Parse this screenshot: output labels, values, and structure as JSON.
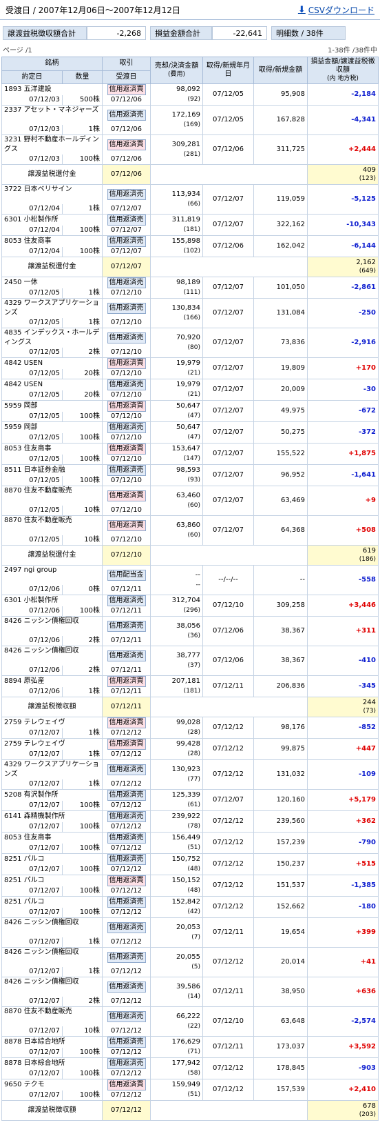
{
  "header": {
    "title": "受渡日 / 2007年12月06日～2007年12月12日",
    "csv_label": "CSVダウンロード"
  },
  "summary": {
    "tax_label": "譲渡益税徴収額合計",
    "tax_value": "-2,268",
    "profit_label": "損益金額合計",
    "profit_value": "-22,641",
    "count_label": "明細数 / 38件"
  },
  "paging": {
    "page": "ページ /1",
    "count": "1-38件 /38件中"
  },
  "columns": {
    "stock": "銘柄",
    "trade_date": "約定日",
    "qty": "数量",
    "type": "取引",
    "settle": "受渡日",
    "sell_amt": "売却/決済金額",
    "fee": "(費用)",
    "acq_date": "取得/新規年月日",
    "acq_amt": "取得/新規金額",
    "pl": "損益金額/譲渡益税徴収額",
    "pl_note": "(内 地方税)"
  },
  "rows": [
    {
      "kind": "trade",
      "stock": "1893 五洋建設",
      "trade": "07/12/03",
      "qty": "500株",
      "type": "信用返済買",
      "side": "buy",
      "settle": "07/12/06",
      "sell": "98,092",
      "fee": "(92)",
      "acq_date": "07/12/05",
      "acq": "95,908",
      "pl": "-2,184"
    },
    {
      "kind": "trade",
      "stock": "2337 アセット・マネジャーズ",
      "trade": "07/12/03",
      "qty": "1株",
      "type": "信用返済売",
      "side": "sell",
      "settle": "07/12/06",
      "sell": "172,169",
      "fee": "(169)",
      "acq_date": "07/12/05",
      "acq": "167,828",
      "pl": "-4,341"
    },
    {
      "kind": "trade",
      "stock": "3231 野村不動産ホールディングス",
      "trade": "07/12/03",
      "qty": "100株",
      "type": "信用返済買",
      "side": "buy",
      "settle": "07/12/06",
      "sell": "309,281",
      "fee": "(281)",
      "acq_date": "07/12/06",
      "acq": "311,725",
      "pl": "+2,444"
    },
    {
      "kind": "tax",
      "label": "譲渡益税還付金",
      "date": "07/12/06",
      "amt": "409",
      "local": "(123)"
    },
    {
      "kind": "trade",
      "stock": "3722 日本ベリサイン",
      "trade": "07/12/04",
      "qty": "1株",
      "type": "信用返済売",
      "side": "sell",
      "settle": "07/12/07",
      "sell": "113,934",
      "fee": "(66)",
      "acq_date": "07/12/07",
      "acq": "119,059",
      "pl": "-5,125"
    },
    {
      "kind": "trade",
      "stock": "6301 小松製作所",
      "trade": "07/12/04",
      "qty": "100株",
      "type": "信用返済売",
      "side": "sell",
      "settle": "07/12/07",
      "sell": "311,819",
      "fee": "(181)",
      "acq_date": "07/12/07",
      "acq": "322,162",
      "pl": "-10,343"
    },
    {
      "kind": "trade",
      "stock": "8053 住友商事",
      "trade": "07/12/04",
      "qty": "100株",
      "type": "信用返済売",
      "side": "sell",
      "settle": "07/12/07",
      "sell": "155,898",
      "fee": "(102)",
      "acq_date": "07/12/06",
      "acq": "162,042",
      "pl": "-6,144"
    },
    {
      "kind": "tax",
      "label": "譲渡益税還付金",
      "date": "07/12/07",
      "amt": "2,162",
      "local": "(649)"
    },
    {
      "kind": "trade",
      "stock": "2450 一休",
      "trade": "07/12/05",
      "qty": "1株",
      "type": "信用返済売",
      "side": "sell",
      "settle": "07/12/10",
      "sell": "98,189",
      "fee": "(111)",
      "acq_date": "07/12/07",
      "acq": "101,050",
      "pl": "-2,861"
    },
    {
      "kind": "trade",
      "stock": "4329 ワークスアプリケーションズ",
      "trade": "07/12/05",
      "qty": "1株",
      "type": "信用返済売",
      "side": "sell",
      "settle": "07/12/10",
      "sell": "130,834",
      "fee": "(166)",
      "acq_date": "07/12/07",
      "acq": "131,084",
      "pl": "-250"
    },
    {
      "kind": "trade",
      "stock": "4835 インデックス・ホールディングス",
      "trade": "07/12/05",
      "qty": "2株",
      "type": "信用返済売",
      "side": "sell",
      "settle": "07/12/10",
      "sell": "70,920",
      "fee": "(80)",
      "acq_date": "07/12/07",
      "acq": "73,836",
      "pl": "-2,916"
    },
    {
      "kind": "trade",
      "stock": "4842 USEN",
      "trade": "07/12/05",
      "qty": "20株",
      "type": "信用返済買",
      "side": "buy",
      "settle": "07/12/10",
      "sell": "19,979",
      "fee": "(21)",
      "acq_date": "07/12/07",
      "acq": "19,809",
      "pl": "+170"
    },
    {
      "kind": "trade",
      "stock": "4842 USEN",
      "trade": "07/12/05",
      "qty": "20株",
      "type": "信用返済売",
      "side": "sell",
      "settle": "07/12/10",
      "sell": "19,979",
      "fee": "(21)",
      "acq_date": "07/12/07",
      "acq": "20,009",
      "pl": "-30"
    },
    {
      "kind": "trade",
      "stock": "5959 岡部",
      "trade": "07/12/05",
      "qty": "100株",
      "type": "信用返済買",
      "side": "buy",
      "settle": "07/12/10",
      "sell": "50,647",
      "fee": "(47)",
      "acq_date": "07/12/07",
      "acq": "49,975",
      "pl": "-672"
    },
    {
      "kind": "trade",
      "stock": "5959 岡部",
      "trade": "07/12/05",
      "qty": "100株",
      "type": "信用返済売",
      "side": "sell",
      "settle": "07/12/10",
      "sell": "50,647",
      "fee": "(47)",
      "acq_date": "07/12/07",
      "acq": "50,275",
      "pl": "-372"
    },
    {
      "kind": "trade",
      "stock": "8053 住友商事",
      "trade": "07/12/05",
      "qty": "100株",
      "type": "信用返済買",
      "side": "buy",
      "settle": "07/12/10",
      "sell": "153,647",
      "fee": "(147)",
      "acq_date": "07/12/07",
      "acq": "155,522",
      "pl": "+1,875"
    },
    {
      "kind": "trade",
      "stock": "8511 日本証券金融",
      "trade": "07/12/05",
      "qty": "100株",
      "type": "信用返済売",
      "side": "sell",
      "settle": "07/12/10",
      "sell": "98,593",
      "fee": "(93)",
      "acq_date": "07/12/07",
      "acq": "96,952",
      "pl": "-1,641"
    },
    {
      "kind": "trade",
      "stock": "8870 住友不動産販売",
      "trade": "07/12/05",
      "qty": "10株",
      "type": "信用返済買",
      "side": "buy",
      "settle": "07/12/10",
      "sell": "63,460",
      "fee": "(60)",
      "acq_date": "07/12/07",
      "acq": "63,469",
      "pl": "+9"
    },
    {
      "kind": "trade",
      "stock": "8870 住友不動産販売",
      "trade": "07/12/05",
      "qty": "10株",
      "type": "信用返済買",
      "side": "buy",
      "settle": "07/12/10",
      "sell": "63,860",
      "fee": "(60)",
      "acq_date": "07/12/07",
      "acq": "64,368",
      "pl": "+508"
    },
    {
      "kind": "tax",
      "label": "譲渡益税還付金",
      "date": "07/12/10",
      "amt": "619",
      "local": "(186)"
    },
    {
      "kind": "trade",
      "stock": "2497 ngi group",
      "trade": "07/12/06",
      "qty": "0株",
      "type": "信用配当金",
      "side": "sell",
      "settle": "07/12/11",
      "sell": "--",
      "fee": "--",
      "acq_date": "--/--/--",
      "acq": "--",
      "pl": "-558"
    },
    {
      "kind": "trade",
      "stock": "6301 小松製作所",
      "trade": "07/12/06",
      "qty": "100株",
      "type": "信用返済売",
      "side": "sell",
      "settle": "07/12/11",
      "sell": "312,704",
      "fee": "(296)",
      "acq_date": "07/12/10",
      "acq": "309,258",
      "pl": "+3,446"
    },
    {
      "kind": "trade",
      "stock": "8426 ニッシン債権回収",
      "trade": "07/12/06",
      "qty": "2株",
      "type": "信用返済売",
      "side": "sell",
      "settle": "07/12/11",
      "sell": "38,056",
      "fee": "(36)",
      "acq_date": "07/12/06",
      "acq": "38,367",
      "pl": "+311"
    },
    {
      "kind": "trade",
      "stock": "8426 ニッシン債権回収",
      "trade": "07/12/06",
      "qty": "2株",
      "type": "信用返済売",
      "side": "sell",
      "settle": "07/12/11",
      "sell": "38,777",
      "fee": "(37)",
      "acq_date": "07/12/06",
      "acq": "38,367",
      "pl": "-410"
    },
    {
      "kind": "trade",
      "stock": "8894 原弘産",
      "trade": "07/12/06",
      "qty": "1株",
      "type": "信用返済買",
      "side": "buy",
      "settle": "07/12/11",
      "sell": "207,181",
      "fee": "(181)",
      "acq_date": "07/12/11",
      "acq": "206,836",
      "pl": "-345"
    },
    {
      "kind": "tax",
      "label": "譲渡益税徴収額",
      "date": "07/12/11",
      "amt": "244",
      "local": "(73)"
    },
    {
      "kind": "trade",
      "stock": "2759 テレウェイヴ",
      "trade": "07/12/07",
      "qty": "1株",
      "type": "信用返済買",
      "side": "buy",
      "settle": "07/12/12",
      "sell": "99,028",
      "fee": "(28)",
      "acq_date": "07/12/12",
      "acq": "98,176",
      "pl": "-852"
    },
    {
      "kind": "trade",
      "stock": "2759 テレウェイヴ",
      "trade": "07/12/07",
      "qty": "1株",
      "type": "信用返済買",
      "side": "buy",
      "settle": "07/12/12",
      "sell": "99,428",
      "fee": "(28)",
      "acq_date": "07/12/12",
      "acq": "99,875",
      "pl": "+447"
    },
    {
      "kind": "trade",
      "stock": "4329 ワークスアプリケーションズ",
      "trade": "07/12/07",
      "qty": "1株",
      "type": "信用返済売",
      "side": "sell",
      "settle": "07/12/12",
      "sell": "130,923",
      "fee": "(77)",
      "acq_date": "07/12/12",
      "acq": "131,032",
      "pl": "-109"
    },
    {
      "kind": "trade",
      "stock": "5208 有沢製作所",
      "trade": "07/12/07",
      "qty": "100株",
      "type": "信用返済売",
      "side": "sell",
      "settle": "07/12/12",
      "sell": "125,339",
      "fee": "(61)",
      "acq_date": "07/12/07",
      "acq": "120,160",
      "pl": "+5,179"
    },
    {
      "kind": "trade",
      "stock": "6141 森精機製作所",
      "trade": "07/12/07",
      "qty": "100株",
      "type": "信用返済売",
      "side": "sell",
      "settle": "07/12/12",
      "sell": "239,922",
      "fee": "(78)",
      "acq_date": "07/12/12",
      "acq": "239,560",
      "pl": "+362"
    },
    {
      "kind": "trade",
      "stock": "8053 住友商事",
      "trade": "07/12/07",
      "qty": "100株",
      "type": "信用返済売",
      "side": "sell",
      "settle": "07/12/12",
      "sell": "156,449",
      "fee": "(51)",
      "acq_date": "07/12/12",
      "acq": "157,239",
      "pl": "-790"
    },
    {
      "kind": "trade",
      "stock": "8251 パルコ",
      "trade": "07/12/07",
      "qty": "100株",
      "type": "信用返済売",
      "side": "sell",
      "settle": "07/12/12",
      "sell": "150,752",
      "fee": "(48)",
      "acq_date": "07/12/12",
      "acq": "150,237",
      "pl": "+515"
    },
    {
      "kind": "trade",
      "stock": "8251 パルコ",
      "trade": "07/12/07",
      "qty": "100株",
      "type": "信用返済買",
      "side": "buy",
      "settle": "07/12/12",
      "sell": "150,152",
      "fee": "(48)",
      "acq_date": "07/12/12",
      "acq": "151,537",
      "pl": "-1,385"
    },
    {
      "kind": "trade",
      "stock": "8251 パルコ",
      "trade": "07/12/07",
      "qty": "100株",
      "type": "信用返済売",
      "side": "sell",
      "settle": "07/12/12",
      "sell": "152,842",
      "fee": "(42)",
      "acq_date": "07/12/12",
      "acq": "152,662",
      "pl": "-180"
    },
    {
      "kind": "trade",
      "stock": "8426 ニッシン債権回収",
      "trade": "07/12/07",
      "qty": "1株",
      "type": "信用返済売",
      "side": "sell",
      "settle": "07/12/12",
      "sell": "20,053",
      "fee": "(7)",
      "acq_date": "07/12/11",
      "acq": "19,654",
      "pl": "+399"
    },
    {
      "kind": "trade",
      "stock": "8426 ニッシン債権回収",
      "trade": "07/12/07",
      "qty": "1株",
      "type": "信用返済売",
      "side": "sell",
      "settle": "07/12/12",
      "sell": "20,055",
      "fee": "(5)",
      "acq_date": "07/12/12",
      "acq": "20,014",
      "pl": "+41"
    },
    {
      "kind": "trade",
      "stock": "8426 ニッシン債権回収",
      "trade": "07/12/07",
      "qty": "2株",
      "type": "信用返済売",
      "side": "sell",
      "settle": "07/12/12",
      "sell": "39,586",
      "fee": "(14)",
      "acq_date": "07/12/11",
      "acq": "38,950",
      "pl": "+636"
    },
    {
      "kind": "trade",
      "stock": "8870 住友不動産販売",
      "trade": "07/12/07",
      "qty": "10株",
      "type": "信用返済売",
      "side": "sell",
      "settle": "07/12/12",
      "sell": "66,222",
      "fee": "(22)",
      "acq_date": "07/12/10",
      "acq": "63,648",
      "pl": "-2,574"
    },
    {
      "kind": "trade",
      "stock": "8878 日本綜合地所",
      "trade": "07/12/07",
      "qty": "100株",
      "type": "信用返済売",
      "side": "sell",
      "settle": "07/12/12",
      "sell": "176,629",
      "fee": "(71)",
      "acq_date": "07/12/11",
      "acq": "173,037",
      "pl": "+3,592"
    },
    {
      "kind": "trade",
      "stock": "8878 日本綜合地所",
      "trade": "07/12/07",
      "qty": "100株",
      "type": "信用返済売",
      "side": "sell",
      "settle": "07/12/12",
      "sell": "177,942",
      "fee": "(58)",
      "acq_date": "07/12/12",
      "acq": "178,845",
      "pl": "-903"
    },
    {
      "kind": "trade",
      "stock": "9650 テクモ",
      "trade": "07/12/07",
      "qty": "100株",
      "type": "信用返済買",
      "side": "buy",
      "settle": "07/12/12",
      "sell": "159,949",
      "fee": "(51)",
      "acq_date": "07/12/12",
      "acq": "157,539",
      "pl": "+2,410"
    },
    {
      "kind": "tax",
      "label": "譲渡益税徴収額",
      "date": "07/12/12",
      "amt": "678",
      "local": "(203)"
    }
  ]
}
